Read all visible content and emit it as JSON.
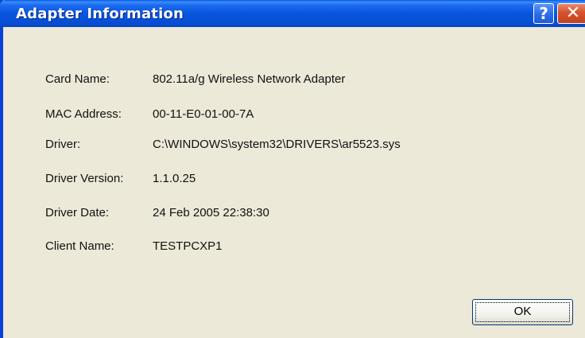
{
  "window": {
    "title": "Adapter Information",
    "help_glyph": "?",
    "close_glyph": "✕"
  },
  "fields": [
    {
      "label": "Card Name:",
      "value": "802.11a/g Wireless Network Adapter"
    },
    {
      "label": "MAC Address:",
      "value": "00-11-E0-01-00-7A"
    },
    {
      "label": "Driver:",
      "value": "C:\\WINDOWS\\system32\\DRIVERS\\ar5523.sys"
    },
    {
      "label": "Driver Version:",
      "value": "1.1.0.25"
    },
    {
      "label": "Driver Date:",
      "value": "24 Feb 2005 22:38:30"
    },
    {
      "label": "Client Name:",
      "value": "TESTPCXP1"
    }
  ],
  "buttons": {
    "ok_label": "OK"
  },
  "icons": [
    "help-icon",
    "close-icon"
  ],
  "colors": {
    "titlebar": "#0855dd",
    "dialog_bg": "#ece9d8",
    "close_button": "#d6532d"
  }
}
